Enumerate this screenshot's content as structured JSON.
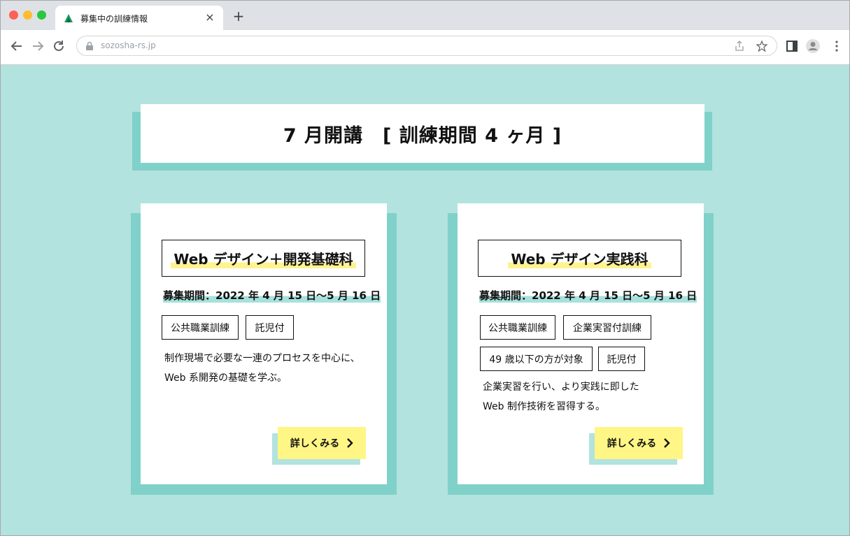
{
  "browser": {
    "tab_title": "募集中の訓練情報",
    "url": "sozosha-rs.jp",
    "new_tab_symbol": "+",
    "close_symbol": "×"
  },
  "page": {
    "heading": "7 月開講　[ 訓練期間 4 ヶ月 ]",
    "courses": [
      {
        "title": "Web デザイン＋開発基礎科",
        "period": "募集期間：2022 年 4 月 15 日〜5 月 16 日",
        "tags": [
          "公共職業訓練",
          "託児付"
        ],
        "desc_lines": [
          "制作現場で必要な一連のプロセスを中心に、",
          "Web 系開発の基礎を学ぶ。"
        ],
        "more_label": "詳しくみる"
      },
      {
        "title": "Web デザイン実践科",
        "period": "募集期間：2022 年 4 月 15 日〜5 月 16 日",
        "tags": [
          "公共職業訓練",
          "企業実習付訓練",
          "49 歳以下の方が対象",
          "託児付"
        ],
        "desc_lines": [
          "企業実習を行い、より実践に即した",
          "Web 制作技術を習得する。"
        ],
        "more_label": "詳しくみる"
      }
    ]
  },
  "colors": {
    "page_bg": "#b2e3df",
    "card_shadow": "#80d1c9",
    "highlight_yellow": "#fff38f",
    "button_yellow": "#fff685",
    "period_highlight": "#a7e1dc"
  }
}
